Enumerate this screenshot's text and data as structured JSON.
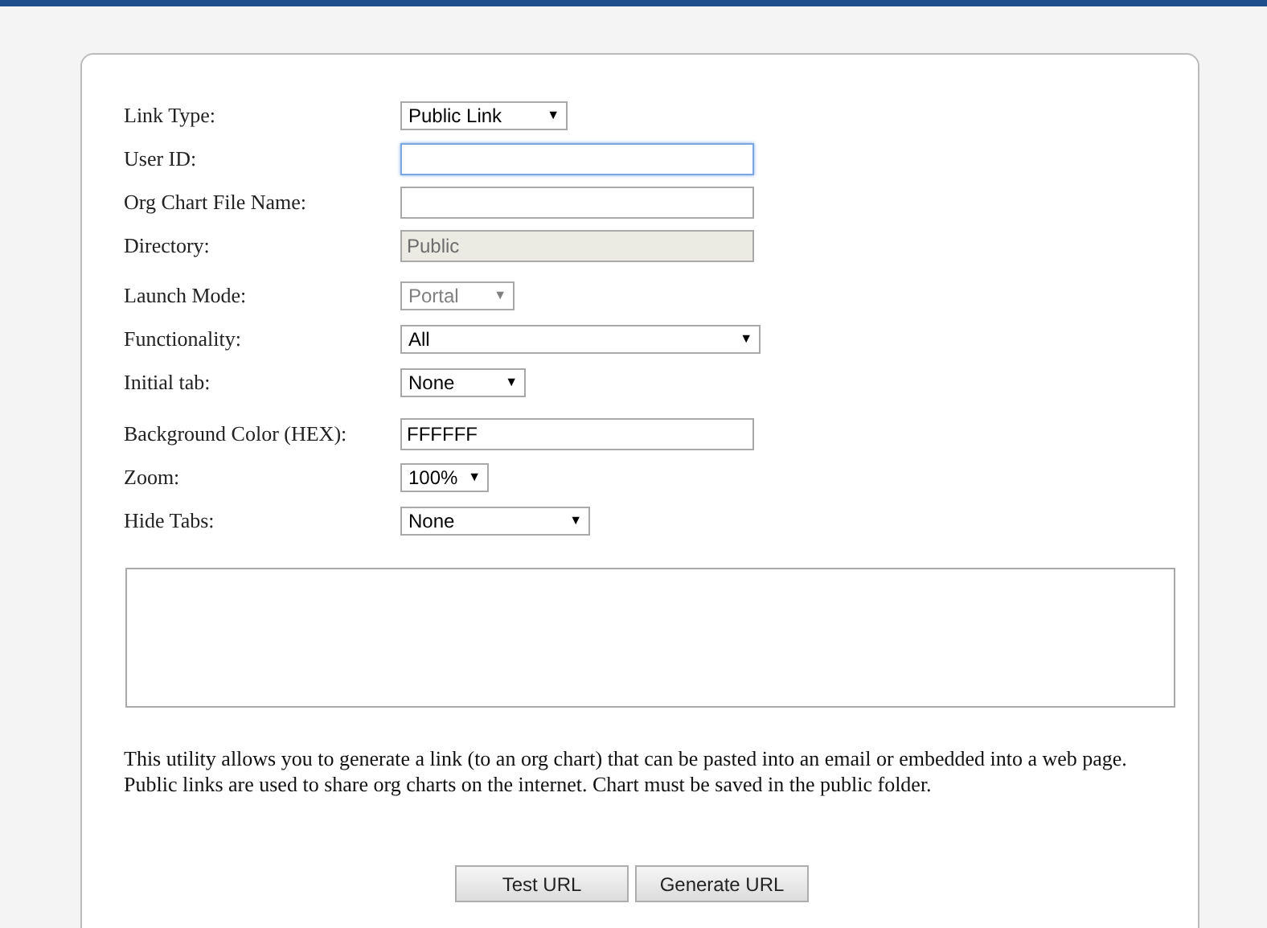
{
  "form": {
    "fields": [
      {
        "label": "Link Type:",
        "kind": "select",
        "value": "Public Link",
        "disabled": false
      },
      {
        "label": "User ID:",
        "kind": "input",
        "focused": true,
        "disabled": false
      },
      {
        "label": "Org Chart File Name:",
        "kind": "input",
        "focused": false,
        "disabled": false
      },
      {
        "label": "Directory:",
        "kind": "input",
        "value": "Public",
        "focused": false,
        "disabled": true
      },
      {
        "label": "Launch Mode:",
        "kind": "select",
        "value": "Portal",
        "disabled": true
      },
      {
        "label": "Functionality:",
        "kind": "select",
        "value": "All",
        "disabled": false
      },
      {
        "label": "Initial tab:",
        "kind": "select",
        "value": "None",
        "disabled": false
      },
      {
        "label": "Background Color (HEX):",
        "kind": "input",
        "value": "FFFFFF",
        "focused": false,
        "disabled": false
      },
      {
        "label": "Zoom:",
        "kind": "select",
        "value": "100%",
        "disabled": false
      },
      {
        "label": "Hide Tabs:",
        "kind": "select",
        "value": "None",
        "disabled": false
      }
    ],
    "arrow": "▼",
    "description": "This utility allows you to generate a link (to an org chart) that can be pasted into an email or embedded into a web page. Public links are used to share org charts on the internet. Chart must be saved in the public folder.",
    "buttons": [
      "Test URL",
      "Generate URL"
    ]
  }
}
